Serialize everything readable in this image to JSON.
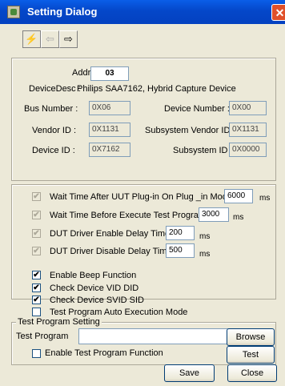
{
  "window": {
    "title": "Setting Dialog",
    "close_glyph": "✕"
  },
  "toolbar": {
    "buttons": [
      {
        "icon": "lightning-icon",
        "glyph": "⚡"
      },
      {
        "icon": "arrow-left-icon",
        "glyph": "⇦"
      },
      {
        "icon": "arrow-right-icon",
        "glyph": "⇨"
      }
    ]
  },
  "device": {
    "addr_label": "Addr :",
    "addr_value": "03",
    "desc_label": "DeviceDesc :",
    "desc_value": "Philips SAA7162, Hybrid Capture Device",
    "bus_label": "Bus Number :",
    "bus_value": "0X06",
    "devnum_label": "Device Number :",
    "devnum_value": "0X00",
    "vendor_label": "Vendor ID :",
    "vendor_value": "0X1131",
    "subvendor_label": "Subsystem Vendor ID :",
    "subvendor_value": "0X1131",
    "devid_label": "Device ID :",
    "devid_value": "0X7162",
    "subsys_label": "Subsystem ID :",
    "subsys_value": "0X0000"
  },
  "timing": {
    "wait_plugin_label": "Wait Time  After UUT Plug-in On  Plug _in Mode :",
    "wait_plugin_value": "6000",
    "wait_plugin_unit": "ms",
    "wait_exec_label": "Wait Time  Before Execute Test Program  :",
    "wait_exec_value": "3000",
    "wait_exec_unit": "ms",
    "enable_delay_label": "DUT Driver Enable Delay Time :",
    "enable_delay_value": "200",
    "enable_delay_unit": "ms",
    "disable_delay_label": "DUT Driver Disable Delay Time :",
    "disable_delay_value": "500",
    "disable_delay_unit": "ms"
  },
  "options": [
    {
      "label": "Enable Beep  Function",
      "checked": true
    },
    {
      "label": "Check Device   VID DID",
      "checked": true
    },
    {
      "label": "Check Device   SVID SID",
      "checked": true
    },
    {
      "label": "Test Program  Auto Execution Mode",
      "checked": false
    }
  ],
  "test_program": {
    "group_title": "Test Program Setting",
    "label": "Test Program",
    "value": "",
    "browse_label": "Browse",
    "test_label": "Test",
    "enable_label": "Enable Test Program Function"
  },
  "footer": {
    "save_label": "Save",
    "close_label": "Close"
  },
  "check_glyph": "✔"
}
